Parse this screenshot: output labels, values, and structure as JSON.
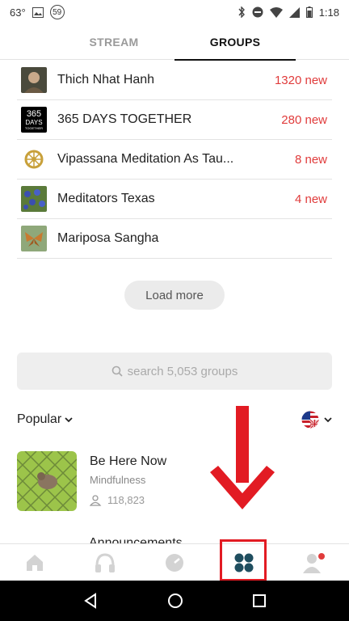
{
  "status_bar": {
    "temperature": "63°",
    "notification_count": "59",
    "time": "1:18"
  },
  "tabs": [
    {
      "label": "STREAM",
      "active": false
    },
    {
      "label": "GROUPS",
      "active": true
    }
  ],
  "groups": [
    {
      "name": "Thich Nhat Hanh",
      "new": "1320 new",
      "thumb": "portrait"
    },
    {
      "name": "365 DAYS TOGETHER",
      "new": "280 new",
      "thumb": "365-logo",
      "thumb_text": [
        "365",
        "DAYS",
        "TOGETHER"
      ]
    },
    {
      "name": "Vipassana Meditation As Tau...",
      "new": "8 new",
      "thumb": "dharma-wheel"
    },
    {
      "name": "Meditators Texas",
      "new": "4 new",
      "thumb": "bluebonnets"
    },
    {
      "name": "Mariposa Sangha",
      "new": "",
      "thumb": "butterfly"
    }
  ],
  "load_more_label": "Load more",
  "search": {
    "placeholder": "search 5,053 groups",
    "icon": "search-icon"
  },
  "sort": {
    "label": "Popular",
    "language_flag": "uk-us-flag"
  },
  "popular_group": {
    "title": "Be Here Now",
    "category": "Mindfulness",
    "members": "118,823"
  },
  "peek_text": "Announcements",
  "bottom_nav": [
    {
      "icon": "home-icon",
      "active": false
    },
    {
      "icon": "headphones-icon",
      "active": false
    },
    {
      "icon": "timer-icon",
      "active": false
    },
    {
      "icon": "groups-icon",
      "active": true
    },
    {
      "icon": "profile-icon",
      "active": false,
      "dot": true
    }
  ],
  "colors": {
    "accent_red": "#e03b3b",
    "active_teal": "#1f4e5f",
    "annotation_red": "#e21b23"
  }
}
